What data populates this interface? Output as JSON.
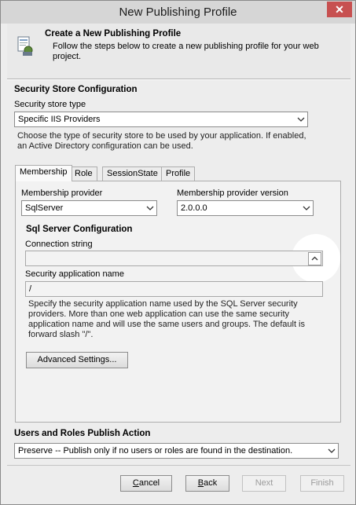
{
  "window": {
    "title": "New Publishing Profile",
    "close_glyph": "✕"
  },
  "header": {
    "title": "Create a New Publishing Profile",
    "description": "Follow the steps below to create a new publishing profile for your web project.",
    "icon": "profile-wizard-icon"
  },
  "security_store": {
    "section_title": "Security Store Configuration",
    "type_label": "Security store type",
    "type_value": "Specific IIS Providers",
    "help": "Choose the type of security store to be used by your application. If enabled, an Active Directory configuration can be used."
  },
  "tabs": [
    "Membership",
    "Role",
    "SessionState",
    "Profile"
  ],
  "membership": {
    "provider_label": "Membership provider",
    "provider_value": "SqlServer",
    "version_label": "Membership provider version",
    "version_value": "2.0.0.0",
    "sql_title": "Sql Server Configuration",
    "connection_label": "Connection string",
    "connection_value": "",
    "app_name_label": "Security application name",
    "app_name_value": "/",
    "app_name_help": "Specify the security application name used by the SQL Server security providers. More than one web application can use the same security application name and will use the same users and groups. The default is forward slash \"/\".",
    "advanced_button": "Advanced Settings..."
  },
  "publish_action": {
    "section_title": "Users and Roles Publish Action",
    "value": "Preserve -- Publish only if no users or roles are found in the destination."
  },
  "buttons": {
    "cancel": {
      "first": "C",
      "rest": "ancel"
    },
    "back": {
      "first": "B",
      "rest": "ack"
    },
    "next": "Next",
    "finish": "Finish"
  },
  "colors": {
    "close": "#c75050",
    "highlight": "#ffffff"
  }
}
